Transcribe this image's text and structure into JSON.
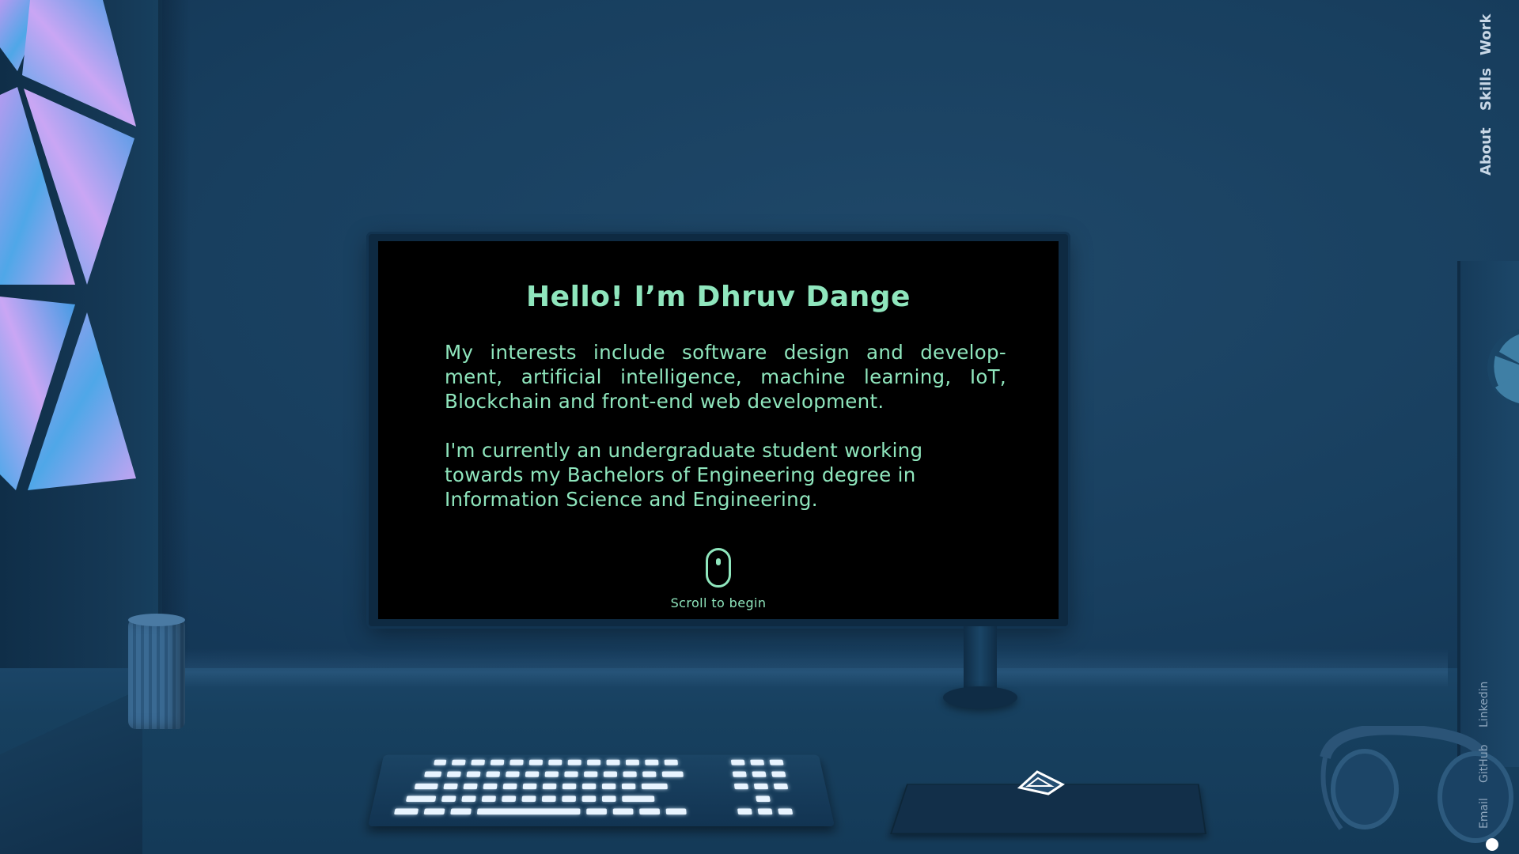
{
  "screen": {
    "title": "Hello! I’m Dhruv Dange",
    "paragraph_1": "My interests include software design and develop- ment, artificial intelligence, machine learning, IoT, Blockchain and front-end web development.",
    "paragraph_2": "I'm currently an undergraduate student working towards my Bachelors of Engineering degree in Information Science and Engineering.",
    "scroll_hint": "Scroll to begin"
  },
  "nav": {
    "items": [
      {
        "label": "Work"
      },
      {
        "label": "Skills"
      },
      {
        "label": "About"
      }
    ]
  },
  "social": {
    "items": [
      {
        "label": "Linkedin"
      },
      {
        "label": "GitHub"
      },
      {
        "label": "Email"
      }
    ]
  },
  "colors": {
    "screen_text": "#8fe6bd",
    "screen_background": "#000000",
    "room": "#163a5a",
    "nav_text": "#c8d7e6"
  },
  "icons": {
    "scroll": "mouse-icon"
  }
}
